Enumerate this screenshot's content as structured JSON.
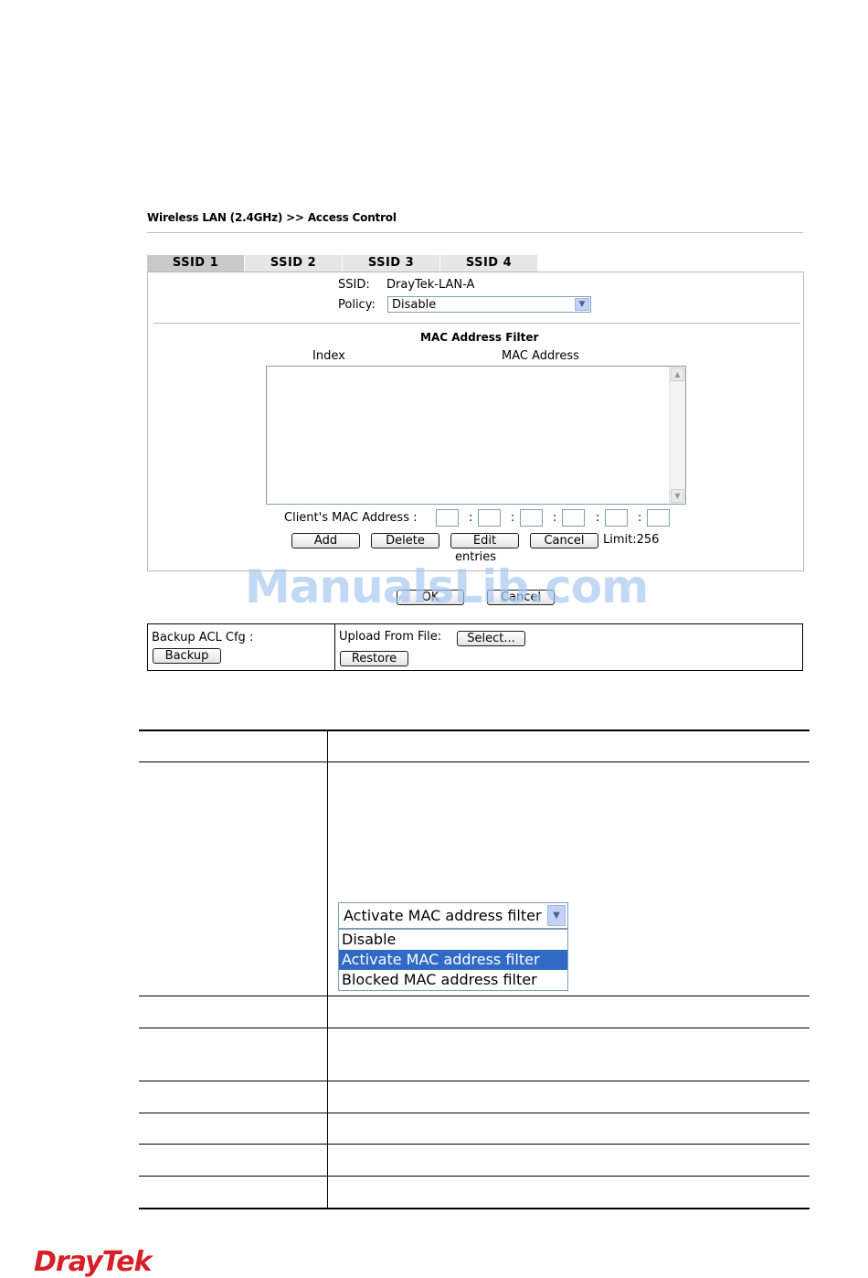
{
  "header": {
    "breadcrumb": "Wireless LAN (2.4GHz) >> Access Control"
  },
  "tabs": [
    {
      "label": "SSID 1",
      "active": true
    },
    {
      "label": "SSID 2",
      "active": false
    },
    {
      "label": "SSID 3",
      "active": false
    },
    {
      "label": "SSID 4",
      "active": false
    }
  ],
  "ssid_panel": {
    "ssid_label": "SSID:",
    "ssid_value": "DrayTek-LAN-A",
    "policy_label": "Policy:",
    "policy_value": "Disable"
  },
  "mac_filter": {
    "title": "MAC Address Filter",
    "col_index": "Index",
    "col_mac": "MAC Address",
    "client_mac_label": "Client's MAC Address :",
    "separator": ":",
    "buttons": {
      "add": "Add",
      "delete": "Delete",
      "edit": "Edit",
      "cancel": "Cancel"
    },
    "limit": "Limit:256",
    "entries": "entries"
  },
  "footer_buttons": {
    "ok": "OK",
    "cancel": "Cancel"
  },
  "watermark": "ManualsLib.com",
  "backup": {
    "label": "Backup ACL Cfg :",
    "backup_button": "Backup",
    "upload_label": "Upload From File:",
    "select_button": "Select...",
    "restore_button": "Restore"
  },
  "policy_dropdown": {
    "selected": "Activate MAC address filter",
    "options": [
      "Disable",
      "Activate MAC address filter",
      "Blocked MAC address filter"
    ],
    "highlighted_index": 1
  },
  "brand": {
    "logo": "DrayTek",
    "color": "#d62027"
  }
}
